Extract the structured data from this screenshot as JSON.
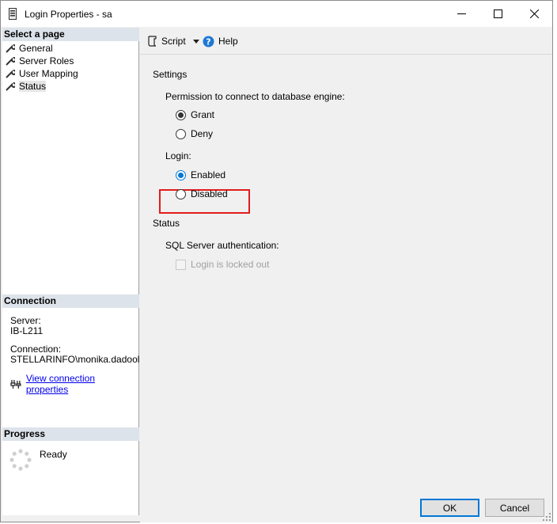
{
  "window": {
    "title": "Login Properties - sa"
  },
  "left": {
    "select_page_header": "Select a page",
    "pages": [
      {
        "label": "General"
      },
      {
        "label": "Server Roles"
      },
      {
        "label": "User Mapping"
      },
      {
        "label": "Status"
      }
    ],
    "connection_header": "Connection",
    "server_label": "Server:",
    "server_value": "IB-L211",
    "connection_label": "Connection:",
    "connection_value": "STELLARINFO\\monika.dadool",
    "view_connection_link": "View connection properties",
    "progress_header": "Progress",
    "progress_status": "Ready"
  },
  "toolbar": {
    "script_label": "Script",
    "help_label": "Help"
  },
  "settings": {
    "header": "Settings",
    "permission_label": "Permission to connect to database engine:",
    "grant_label": "Grant",
    "deny_label": "Deny",
    "permission_selected": "Grant",
    "login_label": "Login:",
    "enabled_label": "Enabled",
    "disabled_label": "Disabled",
    "login_selected": "Enabled"
  },
  "status": {
    "header": "Status",
    "sql_auth_label": "SQL Server authentication:",
    "locked_out_label": "Login is locked out"
  },
  "buttons": {
    "ok": "OK",
    "cancel": "Cancel"
  },
  "colors": {
    "highlight_border": "#e21c1c",
    "focus_blue": "#0078d7",
    "section_header_bg": "#dde3ea"
  }
}
